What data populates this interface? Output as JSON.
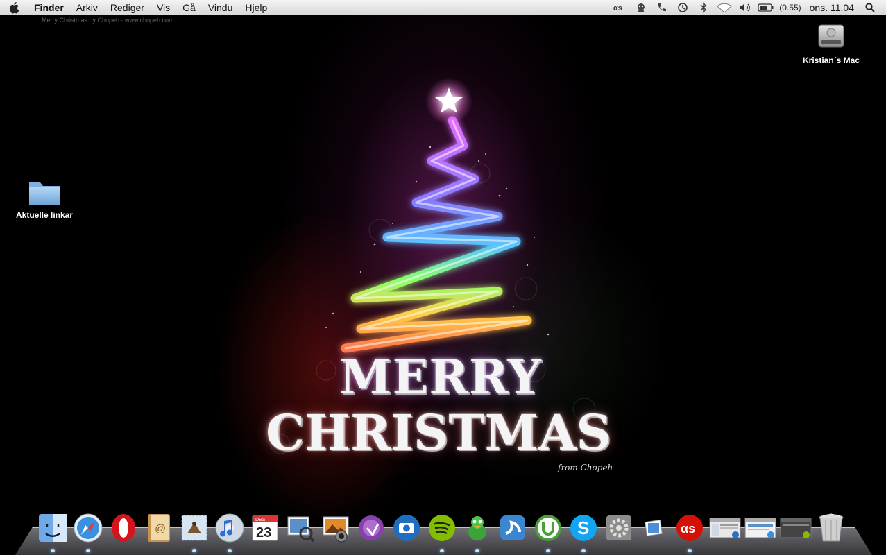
{
  "menubar": {
    "items": [
      "Finder",
      "Arkiv",
      "Rediger",
      "Vis",
      "Gå",
      "Vindu",
      "Hjelp"
    ],
    "status": {
      "lastfm_icon": "lastfm-icon",
      "adium_icon": "adium-duck-icon",
      "phone_icon": "phone-icon",
      "time_machine_icon": "time-machine-icon",
      "bluetooth_icon": "bluetooth-icon",
      "wifi_icon": "wifi-icon",
      "volume_icon": "volume-icon",
      "battery_icon": "battery-icon",
      "battery_text": "(0.55)",
      "clock": "ons. 11.04",
      "spotlight_icon": "spotlight-icon"
    }
  },
  "wallpaper": {
    "line1": "MERRY",
    "line2": "CHRISTMAS",
    "signature": "from Chopeh",
    "watermark": "Merry Christmas by Chopeh · www.chopeh.com"
  },
  "desktop": {
    "icons": [
      {
        "label": "Kristian´s Mac",
        "kind": "hard-drive-icon"
      },
      {
        "label": "Aktuelle linkar",
        "kind": "folder-icon"
      }
    ]
  },
  "dock": {
    "apps": [
      {
        "name": "finder",
        "running": true
      },
      {
        "name": "safari",
        "running": true
      },
      {
        "name": "opera",
        "running": false
      },
      {
        "name": "address-book",
        "running": false
      },
      {
        "name": "mail",
        "running": true
      },
      {
        "name": "itunes",
        "running": true
      },
      {
        "name": "ical",
        "running": false
      },
      {
        "name": "preview",
        "running": false
      },
      {
        "name": "iphoto",
        "running": false
      },
      {
        "name": "front-row",
        "running": false
      },
      {
        "name": "photo-booth",
        "running": false
      },
      {
        "name": "spotify",
        "running": true
      },
      {
        "name": "adium",
        "running": true
      },
      {
        "name": "textwrangler",
        "running": false
      },
      {
        "name": "utorrent",
        "running": true
      },
      {
        "name": "skype",
        "running": true
      },
      {
        "name": "system-preferences",
        "running": false
      },
      {
        "name": "picture-stack",
        "running": false
      },
      {
        "name": "lastfm",
        "running": true
      },
      {
        "name": "minimized-itunes-window",
        "running": false
      },
      {
        "name": "minimized-safari-window",
        "running": false
      },
      {
        "name": "minimized-spotify-window",
        "running": false
      },
      {
        "name": "trash",
        "running": false
      }
    ],
    "calendar_month": "DES",
    "calendar_day": "23"
  },
  "colors": {
    "menubar_top": "#f4f4f4",
    "menubar_bottom": "#d9d9d9",
    "desktop_bg": "#000000",
    "opera_red": "#d6141b",
    "spotify_green": "#84bd00",
    "skype_blue": "#12a5f4",
    "utorrent_green": "#48a136"
  }
}
